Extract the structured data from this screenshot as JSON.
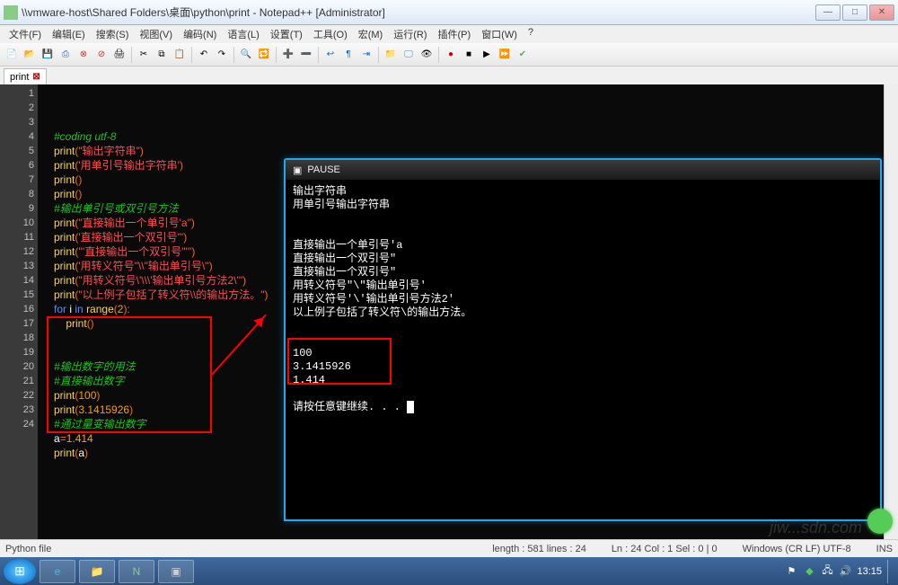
{
  "window": {
    "title": "\\\\vmware-host\\Shared Folders\\桌面\\python\\print - Notepad++ [Administrator]"
  },
  "menu": [
    "文件(F)",
    "编辑(E)",
    "搜索(S)",
    "视图(V)",
    "编码(N)",
    "语言(L)",
    "设置(T)",
    "工具(O)",
    "宏(M)",
    "运行(R)",
    "插件(P)",
    "窗口(W)",
    "?"
  ],
  "tab": {
    "name": "print"
  },
  "code": {
    "lines": [
      {
        "n": 1,
        "cls": "c-comment",
        "t": "#coding utf-8"
      },
      {
        "n": 2,
        "html": "<span class='c-fn'>print</span><span class='c-op'>(</span><span class='c-str'>\"输出字符串\"</span><span class='c-op'>)</span>"
      },
      {
        "n": 3,
        "html": "<span class='c-fn'>print</span><span class='c-op'>(</span><span class='c-str'>'用单引号输出字符串'</span><span class='c-op'>)</span>"
      },
      {
        "n": 4,
        "html": "<span class='c-fn'>print</span><span class='c-op'>()</span>"
      },
      {
        "n": 5,
        "html": "<span class='c-fn'>print</span><span class='c-op'>()</span>"
      },
      {
        "n": 6,
        "cls": "c-comment",
        "t": "#输出单引号或双引号方法"
      },
      {
        "n": 7,
        "html": "<span class='c-fn'>print</span><span class='c-op'>(</span><span class='c-str'>\"直接输出一个单引号'a\"</span><span class='c-op'>)</span>"
      },
      {
        "n": 8,
        "html": "<span class='c-fn'>print</span><span class='c-op'>(</span><span class='c-str'>'直接输出一个双引号\"'</span><span class='c-op'>)</span>"
      },
      {
        "n": 9,
        "html": "<span class='c-fn'>print</span><span class='c-op'>(</span><span class='c-str'>'''直接输出一个双引号\"'''</span><span class='c-op'>)</span>"
      },
      {
        "n": 10,
        "html": "<span class='c-fn'>print</span><span class='c-op'>(</span><span class='c-str'>'用转义符号\"\\\\\"输出单引号\\''</span><span class='c-op'>)</span>"
      },
      {
        "n": 11,
        "html": "<span class='c-fn'>print</span><span class='c-op'>(</span><span class='c-str'>\"用转义符号\\'\\\\\\'输出单引号方法2\\'\"</span><span class='c-op'>)</span>"
      },
      {
        "n": 12,
        "html": "<span class='c-fn'>print</span><span class='c-op'>(</span><span class='c-str'>\"以上例子包括了转义符\\\\的输出方法。\"</span><span class='c-op'>)</span>"
      },
      {
        "n": 13,
        "html": "<span class='c-kw'>for</span> <span class='c-var'>i</span> <span class='c-kw'>in</span> <span class='c-fn'>range</span><span class='c-op'>(</span><span class='c-num'>2</span><span class='c-op'>)</span><span class='c-op'>:</span>"
      },
      {
        "n": 14,
        "html": "    <span class='c-fn'>print</span><span class='c-op'>()</span>"
      },
      {
        "n": 15,
        "t": ""
      },
      {
        "n": 16,
        "t": ""
      },
      {
        "n": 17,
        "cls": "c-comment",
        "t": "#输出数字的用法"
      },
      {
        "n": 18,
        "cls": "c-comment",
        "t": "#直接输出数字"
      },
      {
        "n": 19,
        "html": "<span class='c-fn'>print</span><span class='c-op'>(</span><span class='c-num'>100</span><span class='c-op'>)</span>"
      },
      {
        "n": 20,
        "html": "<span class='c-fn'>print</span><span class='c-op'>(</span><span class='c-num'>3.1415926</span><span class='c-op'>)</span>"
      },
      {
        "n": 21,
        "cls": "c-comment",
        "t": "#通过量变输出数字"
      },
      {
        "n": 22,
        "html": "<span class='c-var'>a</span><span class='c-op'>=</span><span class='c-num'>1.414</span>"
      },
      {
        "n": 23,
        "html": "<span class='c-fn'>print</span><span class='c-op'>(</span><span class='c-var'>a</span><span class='c-op'>)</span>"
      },
      {
        "n": 24,
        "t": ""
      }
    ]
  },
  "console": {
    "title": "PAUSE",
    "lines": [
      "输出字符串",
      "用单引号输出字符串",
      "",
      "",
      "直接输出一个单引号'a",
      "直接输出一个双引号\"",
      "直接输出一个双引号\"",
      "用转义符号\"\\\"输出单引号'",
      "用转义符号'\\'输出单引号方法2'",
      "以上例子包括了转义符\\的输出方法。",
      "",
      "",
      "100",
      "3.1415926",
      "1.414",
      "",
      "请按任意键继续. . . "
    ]
  },
  "status": {
    "type": "Python file",
    "length": "length : 581    lines : 24",
    "pos": "Ln : 24    Col : 1    Sel : 0 | 0",
    "enc": "Windows (CR LF)   UTF-8",
    "mode": "INS"
  },
  "tray": {
    "time": "13:15"
  }
}
